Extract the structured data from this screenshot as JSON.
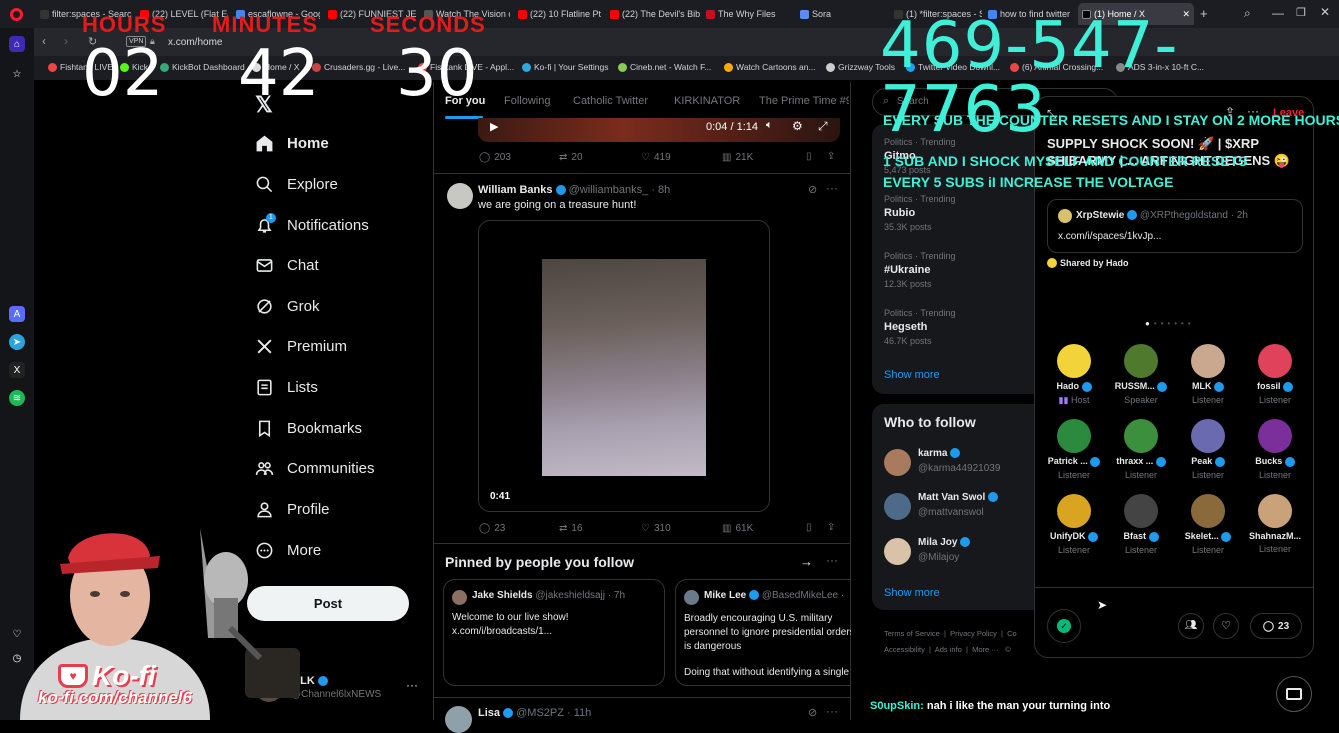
{
  "browser": {
    "tabs": [
      {
        "label": "filter:spaces - Search",
        "active": false
      },
      {
        "label": "(22) LEVEL (Flat Earth)",
        "active": false
      },
      {
        "label": "escaflowne - Google",
        "active": false
      },
      {
        "label": "(22) FUNNIEST JERE",
        "active": false
      },
      {
        "label": "Watch The Vision of",
        "active": false
      },
      {
        "label": "(22) 10 Flatline Pt 2",
        "active": false
      },
      {
        "label": "(22) The Devil's Bible",
        "active": false
      },
      {
        "label": "The Why Files",
        "active": false
      },
      {
        "label": "Sora",
        "active": false
      },
      {
        "label": "(1) *filter:spaces - S",
        "active": false
      },
      {
        "label": "how to find twitter",
        "active": false
      },
      {
        "label": "(1) Home / X",
        "active": true
      }
    ],
    "url": "x.com/home",
    "vpn_badge": "VPN",
    "bookmarks": [
      "Fishtank LIVE",
      "Kick",
      "KickBot Dashboard",
      "Home / X",
      "Crusaders.gg - Live...",
      "Fishtank LIVE - Appl...",
      "Ko-fi | Your Settings",
      "Cineb.net - Watch F...",
      "Watch Cartoons an...",
      "Grizzway Tools",
      "Twitter Video Downl...",
      "(6) Animal Crossing...",
      "ADS 3-in-x 10-ft C..."
    ]
  },
  "sidebar": {
    "items": [
      {
        "label": "Home",
        "icon": "home-icon"
      },
      {
        "label": "Explore",
        "icon": "search-icon"
      },
      {
        "label": "Notifications",
        "icon": "bell-icon",
        "badge": "1"
      },
      {
        "label": "Chat",
        "icon": "mail-icon"
      },
      {
        "label": "Grok",
        "icon": "grok-icon"
      },
      {
        "label": "Premium",
        "icon": "x-logo-icon"
      },
      {
        "label": "Lists",
        "icon": "list-icon"
      },
      {
        "label": "Bookmarks",
        "icon": "bookmark-icon"
      },
      {
        "label": "Communities",
        "icon": "communities-icon"
      },
      {
        "label": "Profile",
        "icon": "person-icon"
      },
      {
        "label": "More",
        "icon": "more-circle-icon"
      }
    ],
    "post_label": "Post",
    "account": {
      "name": "MLK",
      "handle": "@Channel6lxNEWS"
    }
  },
  "feed": {
    "tabs": [
      "For you",
      "Following",
      "Catholic Twitter",
      "KIRKINATOR",
      "The Prime Time #9"
    ],
    "top_post": {
      "time": "0:04 / 1:14",
      "replies": "203",
      "reposts": "20",
      "likes": "419",
      "views": "21K"
    },
    "post": {
      "name": "William Banks",
      "handle": "@williambanks_",
      "time": "· 8h",
      "text": "we are going on a treasure hunt!",
      "video_time": "0:41",
      "replies": "23",
      "reposts": "16",
      "likes": "310",
      "views": "61K"
    },
    "pinned": {
      "title": "Pinned by people you follow",
      "cards": [
        {
          "name": "Jake Shields",
          "handle": "@jakeshieldsajj",
          "time": "· 7h",
          "text": "Welcome to our live show!",
          "link": "x.com/i/broadcasts/1..."
        },
        {
          "name": "Mike Lee",
          "handle": "@BasedMikeLee",
          "time": "·",
          "text": "Broadly encouraging U.S. military personnel to ignore presidential orders is dangerous",
          "text2": "Doing that without identifying a single"
        }
      ]
    },
    "next_post": {
      "name": "Lisa",
      "handle": "@MS2PZ",
      "time": "· 11h"
    }
  },
  "right": {
    "search_placeholder": "Search",
    "trends": [
      {
        "category": "Politics · Trending",
        "name": "Gitmo",
        "count": "5,473 posts"
      },
      {
        "category": "Politics · Trending",
        "name": "Rubio",
        "count": "35.3K posts"
      },
      {
        "category": "Politics · Trending",
        "name": "#Ukraine",
        "count": "12.3K posts"
      },
      {
        "category": "Politics · Trending",
        "name": "Hegseth",
        "count": "46.7K posts"
      }
    ],
    "show_more": "Show more",
    "who_to_follow": {
      "title": "Who to follow",
      "people": [
        {
          "name": "karma",
          "handle": "@karma44921039"
        },
        {
          "name": "Matt Van Swol",
          "handle": "@mattvanswol"
        },
        {
          "name": "Mila Joy",
          "handle": "@Milajoy"
        }
      ],
      "show_more": "Show more"
    },
    "footer": [
      "Terms of Service",
      "Privacy Policy",
      "Co",
      "Accessibility",
      "Ads info",
      "More ···",
      "©"
    ]
  },
  "space": {
    "leave": "Leave",
    "title": "SUPPLY SHOCK SOON! 🚀 | $XRP SHIBARMY | ... ARF NIGHT DEGENS 😜",
    "shared_post": {
      "name": "XrpStewie",
      "handle": "@XRPthegoldstand",
      "time": "· 2h",
      "link": "x.com/i/spaces/1kvJp..."
    },
    "shared_by": "Shared by Hado",
    "participants": [
      {
        "name": "Hado",
        "role": "Host",
        "color": "#f2d43a"
      },
      {
        "name": "RUSSM...",
        "role": "Speaker",
        "color": "#4f7a2e"
      },
      {
        "name": "MLK",
        "role": "Listener",
        "color": "#c9a88f"
      },
      {
        "name": "fossil",
        "role": "Listener",
        "color": "#e0425b"
      },
      {
        "name": "Patrick ...",
        "role": "Listener",
        "color": "#2b8a3e"
      },
      {
        "name": "thraxx ...",
        "role": "Listener",
        "color": "#3c8f3c"
      },
      {
        "name": "Peak",
        "role": "Listener",
        "color": "#6a6ab0"
      },
      {
        "name": "Bucks",
        "role": "Listener",
        "color": "#7a2f9a"
      },
      {
        "name": "UnifyDK",
        "role": "Listener",
        "color": "#d9a520"
      },
      {
        "name": "Bfast",
        "role": "Listener",
        "color": "#444"
      },
      {
        "name": "Skelet...",
        "role": "Listener",
        "color": "#8a6a3a"
      },
      {
        "name": "ShahnazM...",
        "role": "Listener",
        "color": "#caa27a"
      }
    ],
    "comment_count": "23"
  },
  "overlay": {
    "timer": {
      "hours_label": "HOURS",
      "minutes_label": "MINUTES",
      "seconds_label": "SECONDS",
      "hours": "02",
      "minutes": "42",
      "seconds": "30"
    },
    "phone": "469-547-7763",
    "lines": [
      "EVERY SUB THE COUNTER RESETS AND I STAY ON 2 MORE HOURS",
      "1 SUB AND I SHOCK MYSELF AND COUNTER RESETS",
      "EVERY 5 SUBS iI INCREASE THE VOLTAGE"
    ],
    "kofi_brand": "Ko-fi",
    "kofi_url": "ko-fi.com/channel6",
    "chat": {
      "user": "S0upSkin:",
      "message": "nah i like the man your turning into"
    }
  },
  "colors": {
    "accent": "#1d9bf0",
    "overlay_red": "#e31b1b",
    "overlay_cyan": "#3ff0d8",
    "leave_red": "#f4212e"
  }
}
